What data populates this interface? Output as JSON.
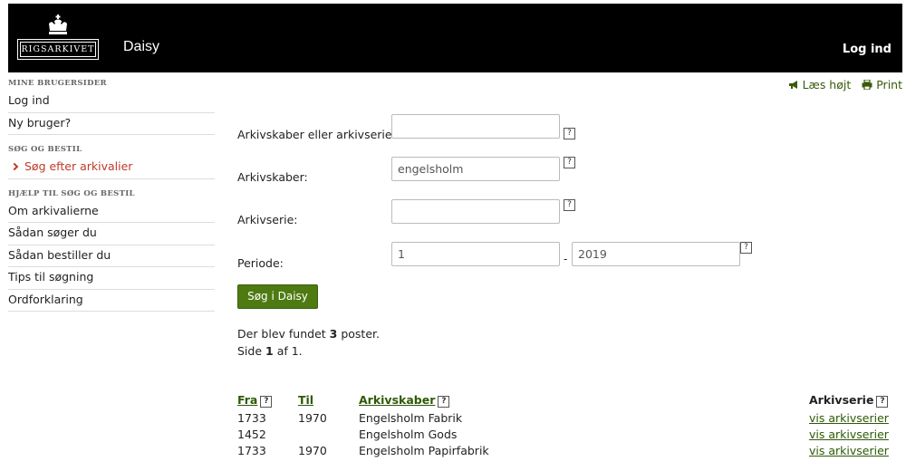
{
  "header": {
    "logo_text": "RIGSARKIVET",
    "app_title": "Daisy",
    "login_label": "Log ind"
  },
  "tools": {
    "read_aloud": "Læs højt",
    "print": "Print",
    "read_aloud_icon": "megaphone-icon",
    "print_icon": "printer-icon"
  },
  "sidebar": {
    "section1_heading": "MINE BRUGERSIDER",
    "section1_items": [
      "Log ind",
      "Ny bruger?"
    ],
    "section2_heading": "SØG OG BESTIL",
    "section2_items": [
      "Søg efter arkivalier"
    ],
    "section3_heading": "HJÆLP TIL SØG OG BESTIL",
    "section3_items": [
      "Om arkivalierne",
      "Sådan søger du",
      "Sådan bestiller du",
      "Tips til søgning",
      "Ordforklaring"
    ]
  },
  "form": {
    "label_combined": "Arkivskaber eller arkivserie:",
    "value_combined": "",
    "label_creator": "Arkivskaber:",
    "value_creator": "engelsholm",
    "label_series": "Arkivserie:",
    "value_series": "",
    "label_period": "Periode:",
    "value_period_from": "1",
    "period_separator": "-",
    "value_period_to": "2019",
    "help_glyph": "?",
    "search_button": "Søg i Daisy"
  },
  "results": {
    "found_prefix": "Der blev fundet ",
    "found_count": "3",
    "found_suffix": " poster.",
    "page_prefix": "Side ",
    "page_current": "1",
    "page_suffix": " af 1."
  },
  "table": {
    "headers": {
      "from": "Fra",
      "to": "Til",
      "creator": "Arkivskaber",
      "series": "Arkivserie"
    },
    "rows": [
      {
        "from": "1733",
        "to": "1970",
        "creator": "Engelsholm Fabrik",
        "series": "vis arkivserier"
      },
      {
        "from": "1452",
        "to": "",
        "creator": "Engelsholm Gods",
        "series": "vis arkivserier"
      },
      {
        "from": "1733",
        "to": "1970",
        "creator": "Engelsholm Papirfabrik",
        "series": "vis arkivserier"
      }
    ]
  }
}
